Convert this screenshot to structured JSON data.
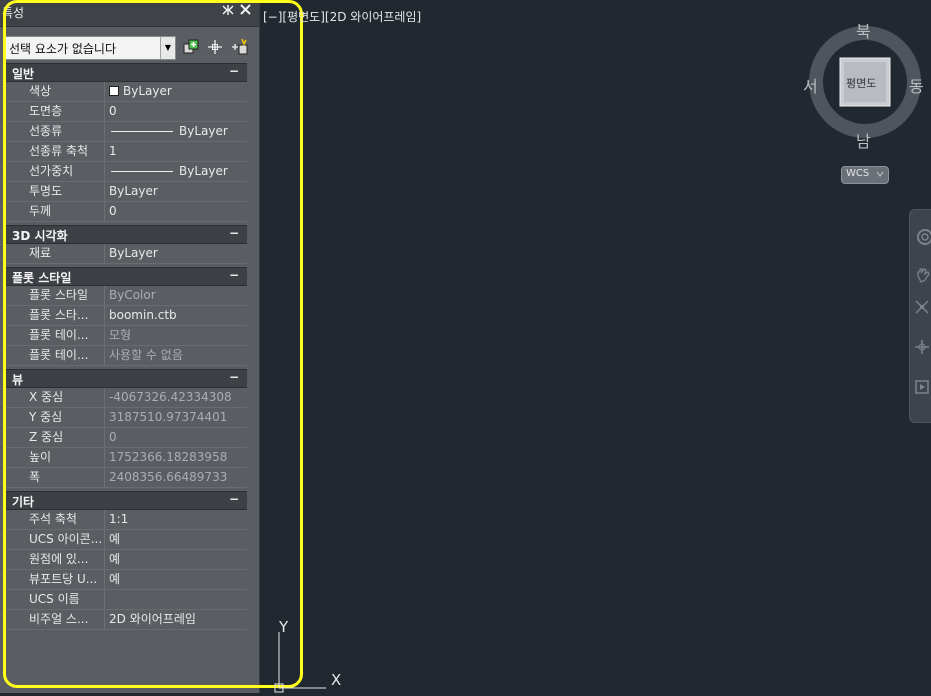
{
  "palette": {
    "title": "특성",
    "selection_label": "선택 요소가 없습니다",
    "sections": [
      {
        "title": "일반",
        "collapse": "−",
        "rows": [
          {
            "name": "색상",
            "value": "ByLayer"
          },
          {
            "name": "도면층",
            "value": "0"
          },
          {
            "name": "선종류",
            "value": "ByLayer"
          },
          {
            "name": "선종류 축척",
            "value": "1"
          },
          {
            "name": "선가중치",
            "value": "ByLayer"
          },
          {
            "name": "투명도",
            "value": "ByLayer"
          },
          {
            "name": "두께",
            "value": "0"
          }
        ]
      },
      {
        "title": "3D 시각화",
        "collapse": "−",
        "rows": [
          {
            "name": "재료",
            "value": "ByLayer"
          }
        ]
      },
      {
        "title": "플롯 스타일",
        "collapse": "−",
        "rows": [
          {
            "name": "플롯 스타일",
            "value": "ByColor"
          },
          {
            "name": "플롯 스타...",
            "value": "boomin.ctb"
          },
          {
            "name": "플롯 테이...",
            "value": "모형"
          },
          {
            "name": "플롯 테이...",
            "value": "사용할 수 없음"
          }
        ]
      },
      {
        "title": "뷰",
        "collapse": "−",
        "rows": [
          {
            "name": "X 중심",
            "value": "-4067326.42334308"
          },
          {
            "name": "Y 중심",
            "value": "3187510.97374401"
          },
          {
            "name": "Z 중심",
            "value": "0"
          },
          {
            "name": "높이",
            "value": "1752366.18283958"
          },
          {
            "name": "폭",
            "value": "2408356.66489733"
          }
        ]
      },
      {
        "title": "기타",
        "collapse": "−",
        "rows": [
          {
            "name": "주석 축척",
            "value": "1:1"
          },
          {
            "name": "UCS 아이콘...",
            "value": "예"
          },
          {
            "name": "원점에 있...",
            "value": "예"
          },
          {
            "name": "뷰포트당 U...",
            "value": "예"
          },
          {
            "name": "UCS 이름",
            "value": ""
          },
          {
            "name": "비주얼 스...",
            "value": "2D 와이어프레임"
          }
        ]
      }
    ]
  },
  "viewport": {
    "label": "[−][평면도][2D 와이어프레임]",
    "viewcube": {
      "north": "북",
      "south": "남",
      "east": "동",
      "west": "서",
      "face": "평면도"
    },
    "wcs_label": "WCS",
    "ucs_y": "Y",
    "ucs_x": "X"
  },
  "colors": {
    "highlight": "#ffff1a",
    "viewport_bg": "#212830",
    "palette_bg": "#5a5e63"
  }
}
